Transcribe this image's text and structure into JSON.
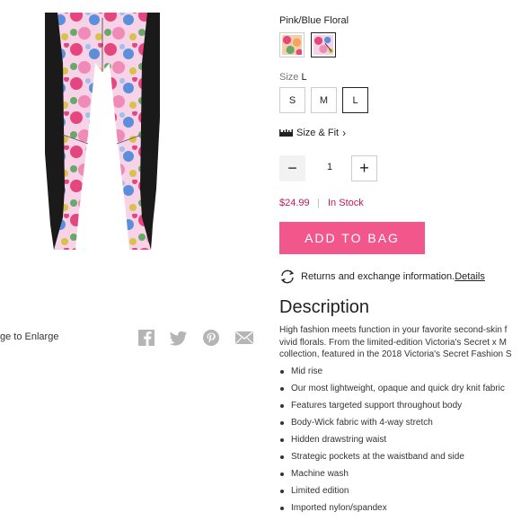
{
  "product": {
    "image_alt": "Pink/Blue Floral leggings"
  },
  "gallery": {
    "enlarge_text": "ge to Enlarge"
  },
  "share": {
    "icons": [
      "facebook-icon",
      "twitter-icon",
      "pinterest-icon",
      "email-icon"
    ]
  },
  "color": {
    "selected_name": "Pink/Blue Floral"
  },
  "size": {
    "label": "Size",
    "selected": "L",
    "options": [
      "S",
      "M",
      "L"
    ],
    "fit_link": "Size & Fit"
  },
  "quantity": {
    "value": "1",
    "minus": "−",
    "plus": "+"
  },
  "price": {
    "amount": "$24.99",
    "separator": "|",
    "stock_status": "In Stock"
  },
  "cta": {
    "add_to_bag": "ADD TO BAG"
  },
  "returns": {
    "text": "Returns and exchange information.",
    "link": "Details"
  },
  "description": {
    "title": "Description",
    "lines": [
      "High fashion meets function in your favorite second-skin f",
      "vivid florals. From the limited-edition Victoria's Secret x M",
      "collection, featured in the 2018 Victoria's Secret Fashion S"
    ],
    "bullets": [
      "Mid rise",
      "Our most lightweight, opaque and quick dry knit fabric",
      "Features targeted support throughout body",
      "Body-Wick fabric with 4-way stretch",
      "Hidden drawstring waist",
      "Strategic pockets at the waistband and side",
      "Machine wash",
      "Limited edition",
      "Imported nylon/spandex"
    ]
  },
  "colors": {
    "accent_pink": "#f1578b",
    "price_pink": "#c2185b",
    "panel_black": "#1a1a1a"
  }
}
